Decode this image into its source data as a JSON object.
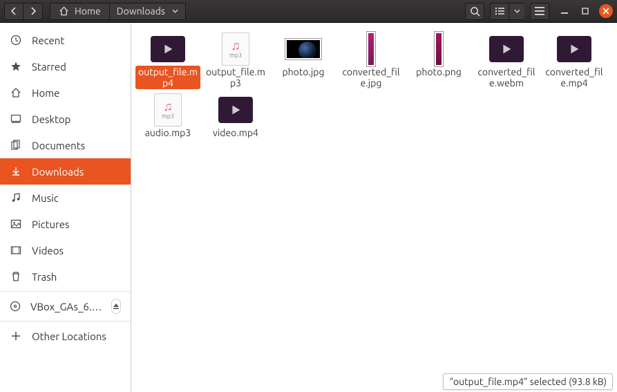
{
  "header": {
    "path": {
      "home_label": "Home",
      "crumb_label": "Downloads"
    }
  },
  "sidebar": {
    "items": [
      {
        "id": "recent",
        "label": "Recent",
        "icon": "clock"
      },
      {
        "id": "starred",
        "label": "Starred",
        "icon": "star"
      },
      {
        "id": "home",
        "label": "Home",
        "icon": "home"
      },
      {
        "id": "desktop",
        "label": "Desktop",
        "icon": "desktop"
      },
      {
        "id": "documents",
        "label": "Documents",
        "icon": "documents"
      },
      {
        "id": "downloads",
        "label": "Downloads",
        "icon": "download",
        "active": true
      },
      {
        "id": "music",
        "label": "Music",
        "icon": "music"
      },
      {
        "id": "pictures",
        "label": "Pictures",
        "icon": "picture"
      },
      {
        "id": "videos",
        "label": "Videos",
        "icon": "video"
      },
      {
        "id": "trash",
        "label": "Trash",
        "icon": "trash"
      }
    ],
    "mount": {
      "label": "VBox_GAs_6.…"
    },
    "other": {
      "label": "Other Locations"
    }
  },
  "files": [
    {
      "name": "output_file.mp4",
      "thumb": "video",
      "selected": true
    },
    {
      "name": "output_file.mp3",
      "thumb": "audio",
      "caption": "mp3"
    },
    {
      "name": "photo.jpg",
      "thumb": "image-earth"
    },
    {
      "name": "converted_file.jpg",
      "thumb": "strip"
    },
    {
      "name": "photo.png",
      "thumb": "strip-magenta"
    },
    {
      "name": "converted_file.webm",
      "thumb": "video"
    },
    {
      "name": "converted_file.mp4",
      "thumb": "video"
    },
    {
      "name": "audio.mp3",
      "thumb": "audio",
      "caption": "mp3"
    },
    {
      "name": "video.mp4",
      "thumb": "video"
    }
  ],
  "statusbar": {
    "text": "“output_file.mp4” selected  (93.8 kB)"
  }
}
